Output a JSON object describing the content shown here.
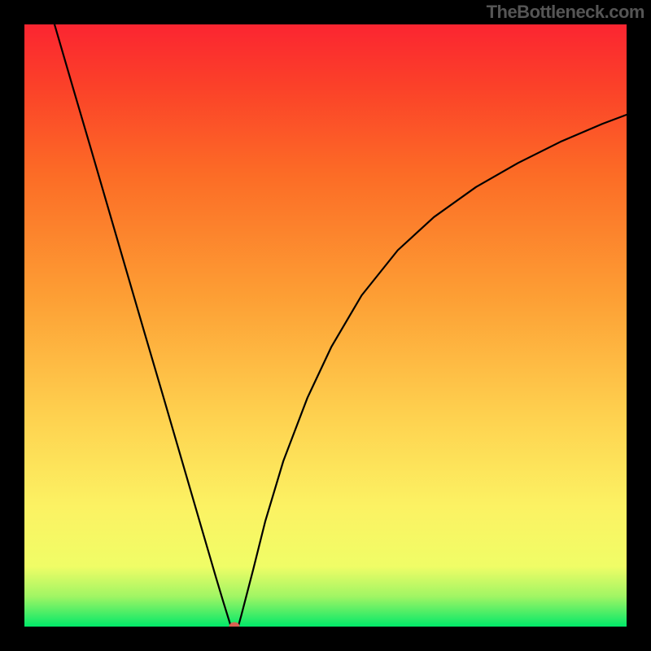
{
  "watermark": "TheBottleneck.com",
  "chart_data": {
    "type": "line",
    "title": "",
    "xlabel": "",
    "ylabel": "",
    "xlim": [
      0,
      100
    ],
    "ylim": [
      0,
      100
    ],
    "gradient_stops": [
      {
        "offset": 0.0,
        "color": "#01e969"
      },
      {
        "offset": 0.02,
        "color": "#42ed67"
      },
      {
        "offset": 0.05,
        "color": "#a0f564"
      },
      {
        "offset": 0.1,
        "color": "#f0fd66"
      },
      {
        "offset": 0.2,
        "color": "#fcf263"
      },
      {
        "offset": 0.35,
        "color": "#fed14f"
      },
      {
        "offset": 0.55,
        "color": "#fd9e34"
      },
      {
        "offset": 0.75,
        "color": "#fc6c26"
      },
      {
        "offset": 0.9,
        "color": "#fb4029"
      },
      {
        "offset": 1.0,
        "color": "#fb2531"
      }
    ],
    "curve": {
      "x": [
        5.0,
        8.0,
        11.0,
        14.0,
        17.0,
        20.0,
        23.0,
        26.0,
        29.0,
        31.8,
        33.0,
        34.3,
        35.5,
        36.0,
        38.0,
        40.0,
        43.0,
        47.0,
        51.0,
        56.0,
        62.0,
        68.0,
        75.0,
        82.0,
        89.0,
        96.0,
        100.0
      ],
      "y": [
        100.0,
        89.7,
        79.5,
        69.2,
        58.9,
        48.6,
        38.4,
        28.1,
        17.8,
        8.2,
        4.2,
        0.0,
        0.0,
        1.8,
        9.5,
        17.5,
        27.5,
        38.0,
        46.5,
        55.0,
        62.5,
        68.0,
        73.0,
        77.0,
        80.5,
        83.5,
        85.0
      ]
    },
    "marker": {
      "x": 34.9,
      "y": 0.0,
      "color": "#da6052"
    }
  }
}
